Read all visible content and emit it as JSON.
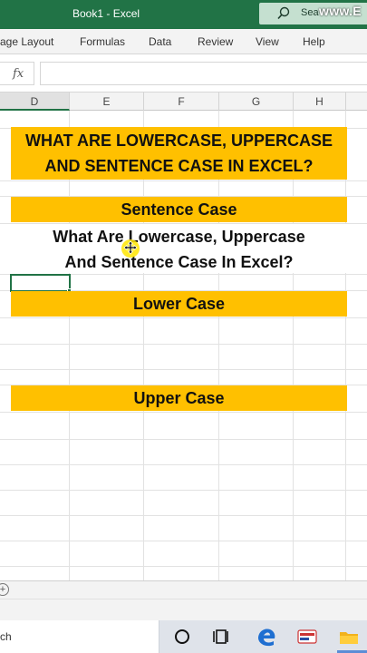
{
  "window": {
    "title": "Book1  -  Excel",
    "search_label": "Sea",
    "watermark": "www.E"
  },
  "ribbon": {
    "tabs": [
      "age Layout",
      "Formulas",
      "Data",
      "Review",
      "View",
      "Help"
    ]
  },
  "formula_bar": {
    "fx_label": "fx",
    "value": ""
  },
  "columns": [
    "D",
    "E",
    "F",
    "G",
    "H"
  ],
  "sheet": {
    "title_line1": "WHAT ARE LOWERCASE, UPPERCASE",
    "title_line2": "AND SENTENCE CASE IN EXCEL?",
    "sentence_case_header": "Sentence Case",
    "sentence_case_line1": "What Are Lowercase, Uppercase",
    "sentence_case_line2": "And Sentence Case In Excel?",
    "lower_case_header": "Lower Case",
    "upper_case_header": "Upper Case"
  },
  "sheet_tabs": {
    "add_label": "+"
  },
  "taskbar": {
    "search_text": "ch"
  },
  "colors": {
    "excel_green": "#217346",
    "band_orange": "#ffc000",
    "cursor_highlight": "#ffe600"
  },
  "icons": [
    "search-icon",
    "fx-icon",
    "move-cursor-icon",
    "add-sheet-icon",
    "cortana-circle-icon",
    "task-view-icon",
    "edge-icon",
    "app-icon",
    "file-explorer-icon"
  ]
}
